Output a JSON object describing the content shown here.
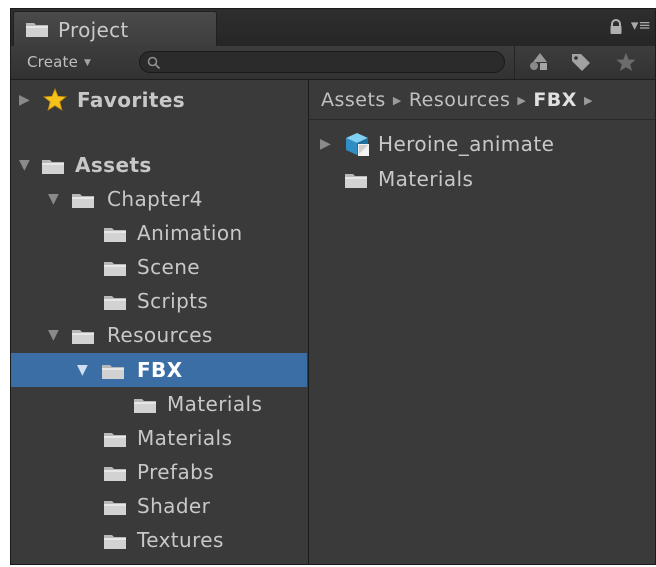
{
  "window": {
    "tab_label": "Project"
  },
  "toolbar": {
    "create_label": "Create",
    "search_placeholder": "",
    "search_value": ""
  },
  "tree": {
    "favorites": "Favorites",
    "assets": "Assets",
    "chapter4": "Chapter4",
    "animation": "Animation",
    "scene": "Scene",
    "scripts": "Scripts",
    "resources": "Resources",
    "fbx": "FBX",
    "fbx_materials": "Materials",
    "materials": "Materials",
    "prefabs": "Prefabs",
    "shader": "Shader",
    "textures": "Textures"
  },
  "breadcrumb": {
    "items": [
      "Assets",
      "Resources",
      "FBX"
    ]
  },
  "files": {
    "item1": "Heroine_animate",
    "item2": "Materials"
  },
  "colors": {
    "selection": "#3b6ea5",
    "background": "#3a3a3a",
    "favorites_star": "#f3c21b",
    "model_cube": "#35a6dc"
  }
}
